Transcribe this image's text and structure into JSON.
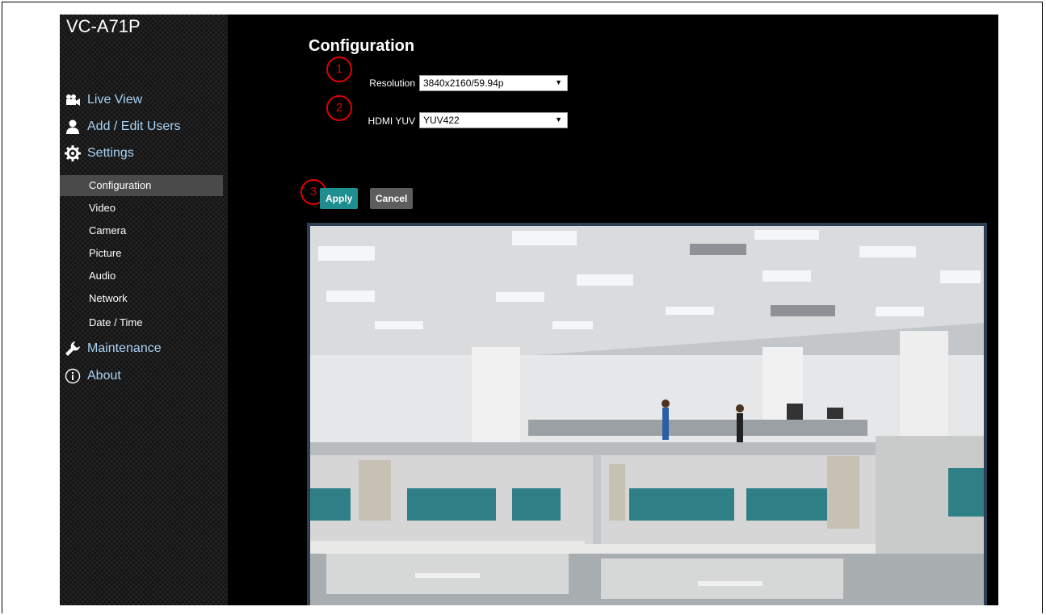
{
  "app": {
    "title": "VC-A71P"
  },
  "nav": {
    "live_view": "Live View",
    "add_edit_users": "Add / Edit Users",
    "settings": "Settings",
    "maintenance": "Maintenance",
    "about": "About"
  },
  "settings_sub": [
    {
      "label": "Configuration",
      "active": true
    },
    {
      "label": "Video"
    },
    {
      "label": "Camera"
    },
    {
      "label": "Picture"
    },
    {
      "label": "Audio"
    },
    {
      "label": "Network"
    },
    {
      "label": "Date / Time"
    }
  ],
  "main": {
    "title": "Configuration",
    "resolution_label": "Resolution",
    "resolution_value": "3840x2160/59.94p",
    "hdmi_label": "HDMI YUV",
    "hdmi_value": "YUV422",
    "apply_label": "Apply",
    "cancel_label": "Cancel"
  },
  "markers": [
    "1",
    "2",
    "3"
  ],
  "icons": {
    "live_view": "video-camera-icon",
    "users": "user-icon",
    "settings": "gear-icon",
    "maintenance": "wrench-icon",
    "about": "info-icon",
    "dropdown": "chevron-down-icon"
  },
  "colors": {
    "nav_text": "#a9d3f5",
    "apply": "#1f8e8e",
    "cancel": "#5d5d5d",
    "marker": "#e00000"
  }
}
